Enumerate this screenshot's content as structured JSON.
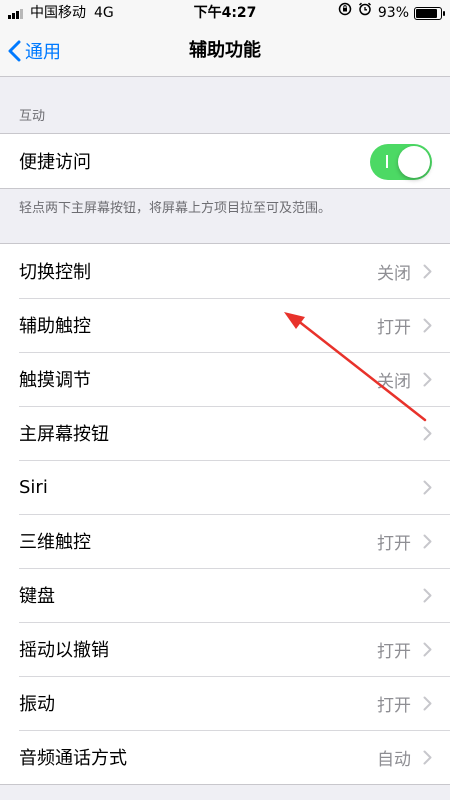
{
  "status_bar": {
    "carrier": "中国移动",
    "network": "4G",
    "time": "下午4:27",
    "battery": "93%",
    "battery_level": 0.93
  },
  "nav": {
    "back_label": "通用",
    "title": "辅助功能"
  },
  "interaction": {
    "section_label": "互动",
    "reachability": {
      "label": "便捷访问",
      "toggle_on": true
    },
    "footer": "轻点两下主屏幕按钮，将屏幕上方项目拉至可及范围。"
  },
  "items": [
    {
      "label": "切换控制",
      "value": "关闭"
    },
    {
      "label": "辅助触控",
      "value": "打开"
    },
    {
      "label": "触摸调节",
      "value": "关闭"
    },
    {
      "label": "主屏幕按钮",
      "value": ""
    },
    {
      "label": "Siri",
      "value": ""
    },
    {
      "label": "三维触控",
      "value": "打开"
    },
    {
      "label": "键盘",
      "value": ""
    },
    {
      "label": "摇动以撤销",
      "value": "打开"
    },
    {
      "label": "振动",
      "value": "打开"
    },
    {
      "label": "音频通话方式",
      "value": "自动"
    }
  ],
  "colors": {
    "accent": "#007aff",
    "toggle_on": "#4cd964",
    "annotation_arrow": "#e8322b"
  }
}
